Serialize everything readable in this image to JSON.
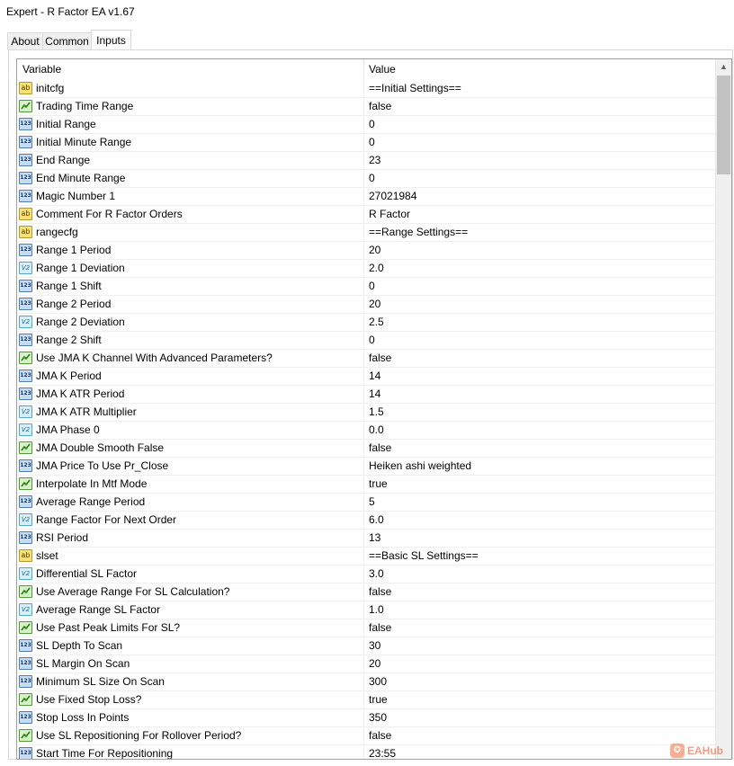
{
  "window": {
    "title": "Expert - R Factor EA v1.67"
  },
  "tabs": [
    {
      "label": "About",
      "active": false
    },
    {
      "label": "Common",
      "active": false
    },
    {
      "label": "Inputs",
      "active": true
    }
  ],
  "grid": {
    "columns": {
      "variable": "Variable",
      "value": "Value"
    },
    "rows": [
      {
        "type": "ab",
        "name": "initcfg",
        "value": "==Initial Settings=="
      },
      {
        "type": "bool",
        "name": "Trading Time Range",
        "value": "false"
      },
      {
        "type": "int",
        "name": "Initial Range",
        "value": "0"
      },
      {
        "type": "int",
        "name": "Initial Minute Range",
        "value": "0"
      },
      {
        "type": "int",
        "name": "End Range",
        "value": "23"
      },
      {
        "type": "int",
        "name": "End Minute Range",
        "value": "0"
      },
      {
        "type": "int",
        "name": "Magic Number 1",
        "value": "27021984"
      },
      {
        "type": "ab",
        "name": "Comment For R Factor Orders",
        "value": "R Factor"
      },
      {
        "type": "ab",
        "name": "rangecfg",
        "value": "==Range Settings=="
      },
      {
        "type": "int",
        "name": "Range 1 Period",
        "value": "20"
      },
      {
        "type": "dbl",
        "name": "Range 1 Deviation",
        "value": "2.0"
      },
      {
        "type": "int",
        "name": "Range 1 Shift",
        "value": "0"
      },
      {
        "type": "int",
        "name": "Range 2 Period",
        "value": "20"
      },
      {
        "type": "dbl",
        "name": "Range 2 Deviation",
        "value": "2.5"
      },
      {
        "type": "int",
        "name": "Range 2 Shift",
        "value": "0"
      },
      {
        "type": "bool",
        "name": "Use JMA K Channel With Advanced Parameters?",
        "value": "false"
      },
      {
        "type": "int",
        "name": "JMA K Period",
        "value": "14"
      },
      {
        "type": "int",
        "name": "JMA K ATR Period",
        "value": "14"
      },
      {
        "type": "dbl",
        "name": "JMA K ATR Multiplier",
        "value": "1.5"
      },
      {
        "type": "dbl",
        "name": "JMA Phase 0",
        "value": "0.0"
      },
      {
        "type": "bool",
        "name": "JMA Double Smooth False",
        "value": "false"
      },
      {
        "type": "int",
        "name": "JMA Price To Use Pr_Close",
        "value": "Heiken ashi weighted"
      },
      {
        "type": "bool",
        "name": "Interpolate In Mtf Mode",
        "value": "true"
      },
      {
        "type": "int",
        "name": "Average Range Period",
        "value": "5"
      },
      {
        "type": "dbl",
        "name": "Range Factor For Next Order",
        "value": "6.0"
      },
      {
        "type": "int",
        "name": "RSI Period",
        "value": "13"
      },
      {
        "type": "ab",
        "name": "slset",
        "value": "==Basic SL Settings=="
      },
      {
        "type": "dbl",
        "name": "Differential SL Factor",
        "value": "3.0"
      },
      {
        "type": "bool",
        "name": "Use Average Range For SL Calculation?",
        "value": "false"
      },
      {
        "type": "dbl",
        "name": "Average Range SL Factor",
        "value": "1.0"
      },
      {
        "type": "bool",
        "name": "Use Past Peak Limits For SL?",
        "value": "false"
      },
      {
        "type": "int",
        "name": "SL Depth To Scan",
        "value": "30"
      },
      {
        "type": "int",
        "name": "SL Margin On Scan",
        "value": "20"
      },
      {
        "type": "int",
        "name": "Minimum SL Size On Scan",
        "value": "300"
      },
      {
        "type": "bool",
        "name": "Use Fixed Stop Loss?",
        "value": "true"
      },
      {
        "type": "int",
        "name": "Stop Loss In Points",
        "value": "350"
      },
      {
        "type": "bool",
        "name": "Use SL Repositioning For Rollover Period?",
        "value": "false"
      },
      {
        "type": "int",
        "name": "Start Time For Repositioning",
        "value": "23:55"
      }
    ]
  },
  "icons": {
    "ab": "string-icon",
    "int": "integer-icon",
    "dbl": "double-icon",
    "bool": "bool-icon"
  },
  "icon_text": {
    "ab": "ab",
    "int": "123",
    "dbl": "V2"
  },
  "scrollbar": {
    "up_glyph": "▲"
  },
  "watermark": {
    "text": "EAHub"
  },
  "colors": {
    "accent": "#4aa02c",
    "string_icon": "#f7e07a",
    "int_icon": "#c7dcf2"
  }
}
